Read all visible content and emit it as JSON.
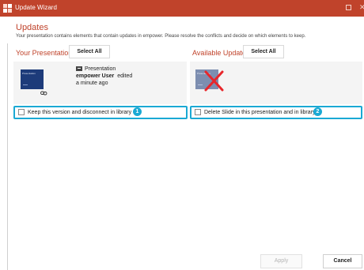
{
  "window": {
    "title": "Update Wizard",
    "colors": {
      "accent": "#c0432b",
      "highlight": "#1aa9d4",
      "thumb": "#1d3b7a"
    }
  },
  "header": {
    "title": "Updates",
    "description": "Your presentation contains elements that contain updates in empower. Please resolve the conflicts and decide on which elements to keep."
  },
  "left": {
    "section_label": "Your Presentation",
    "select_all_label": "Select All",
    "thumbnail_text": "Presentation",
    "item": {
      "type_label": "Presentation",
      "author": "empower User",
      "action": "edited",
      "time": "a minute ago"
    },
    "option": {
      "label": "Keep this version and disconnect in library",
      "badge": "1",
      "checked": false
    }
  },
  "right": {
    "section_label": "Available Updates",
    "select_all_label": "Select All",
    "thumbnail_text": "Presentation",
    "option": {
      "label": "Delete Slide in this presentation and in library",
      "badge": "2",
      "checked": false
    }
  },
  "footer": {
    "apply_label": "Apply",
    "cancel_label": "Cancel",
    "apply_enabled": false
  },
  "icons": {
    "app": "empower-logo-icon",
    "link": "link-icon",
    "delete_mark": "red-x-icon",
    "presentation": "powerpoint-icon"
  }
}
